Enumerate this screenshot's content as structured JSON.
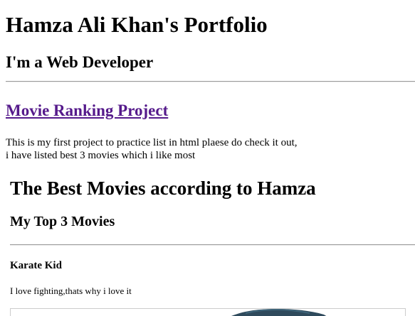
{
  "portfolio": {
    "title": "Hamza Ali Khan's Portfolio",
    "subtitle": "I'm a Web Developer",
    "project_link": "Movie Ranking Project",
    "project_desc_line1": "This is my first project to practice list in html plaese do check it out,",
    "project_desc_line2": "i have listed best 3 movies which i like most"
  },
  "movies_page": {
    "title": "The Best Movies according to Hamza",
    "subtitle": "My Top 3 Movies",
    "movies": [
      {
        "name": "Karate Kid",
        "description": "I love fighting,thats why i love it",
        "image": "movie-poster"
      }
    ]
  },
  "colors": {
    "link_visited": "#551a8b",
    "text": "#000000",
    "background": "#ffffff"
  }
}
